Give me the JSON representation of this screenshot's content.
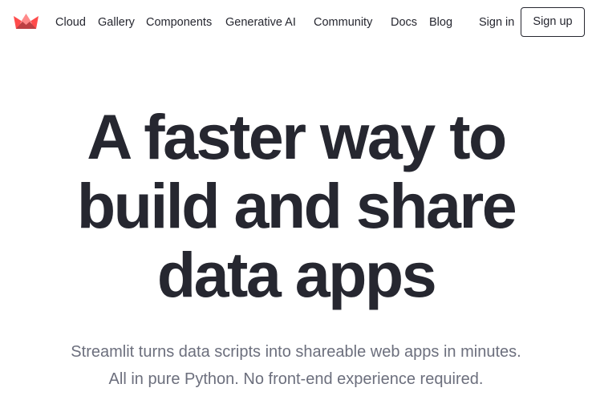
{
  "brand": {
    "logo_icon": "streamlit-crown-icon",
    "colors": {
      "logo_red": "#ff4b4b",
      "logo_dark_red": "#bd4043",
      "logo_pink": "#ff8a8a",
      "text_dark": "#262730",
      "text_muted": "#6c6f7d",
      "background": "#ffffff"
    }
  },
  "nav": {
    "links": {
      "cloud": "Cloud",
      "gallery": "Gallery",
      "components": "Components",
      "generative_ai": "Generative AI",
      "community": "Community",
      "docs": "Docs",
      "blog": "Blog"
    },
    "sign_in": "Sign in",
    "sign_up": "Sign up"
  },
  "hero": {
    "headline_lines": [
      "A faster way to",
      "build and share",
      "data apps"
    ],
    "subheadline_lines": [
      "Streamlit turns data scripts into shareable web apps in minutes.",
      "All in pure Python. No front-end experience required."
    ]
  }
}
